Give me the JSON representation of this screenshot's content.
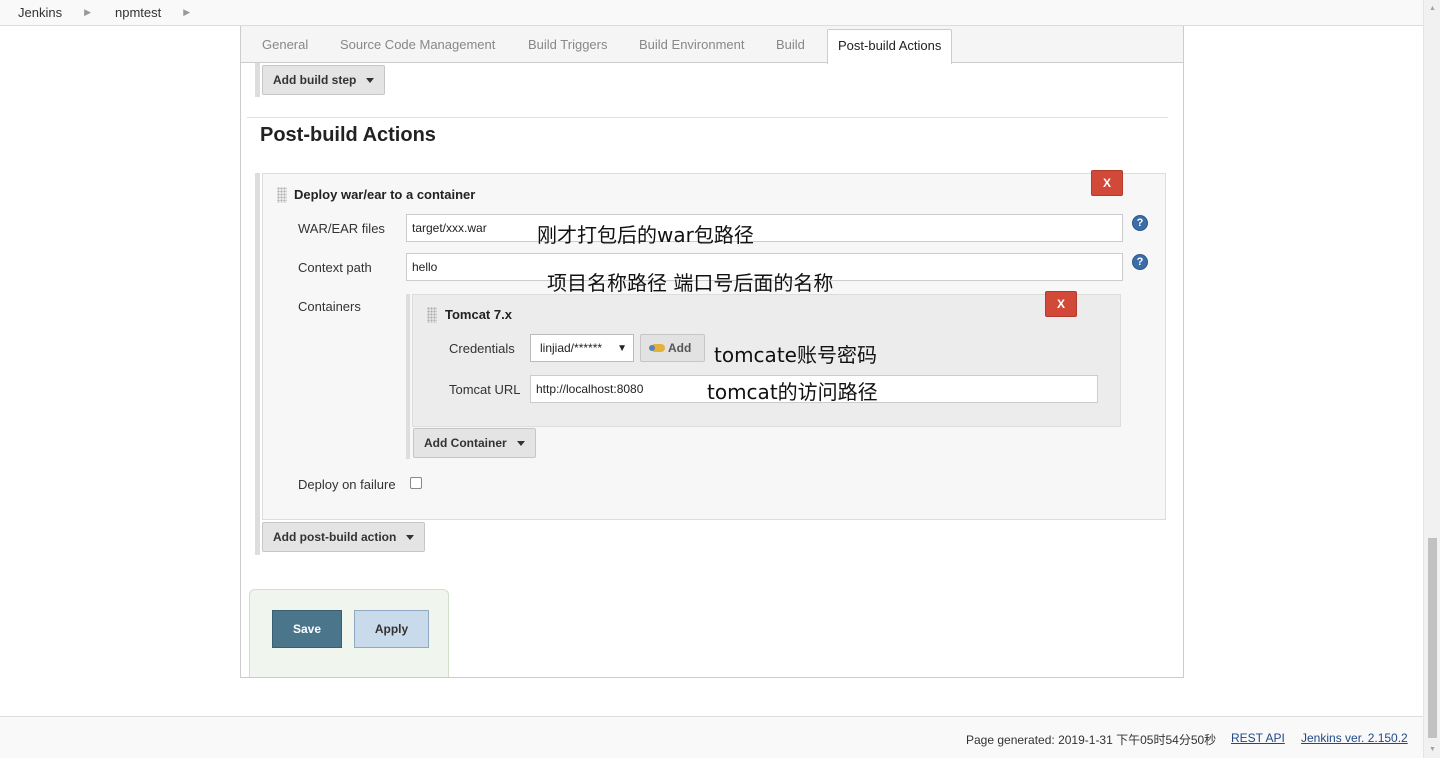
{
  "breadcrumb": {
    "items": [
      "Jenkins",
      "npmtest"
    ]
  },
  "tabs": [
    "General",
    "Source Code Management",
    "Build Triggers",
    "Build Environment",
    "Build",
    "Post-build Actions"
  ],
  "active_tab": "Post-build Actions",
  "build": {
    "add_step_label": "Add build step"
  },
  "post_build": {
    "title": "Post-build Actions",
    "deploy": {
      "title": "Deploy war/ear to a container",
      "remove_label": "X",
      "war_label": "WAR/EAR files",
      "war_value": "target/xxx.war",
      "context_label": "Context path",
      "context_value": "hello",
      "containers_label": "Containers",
      "container": {
        "title": "Tomcat 7.x",
        "remove_label": "X",
        "credentials_label": "Credentials",
        "credentials_value": "linjiad/******",
        "add_label": "Add",
        "url_label": "Tomcat URL",
        "url_value": "http://localhost:8080"
      },
      "add_container_label": "Add Container",
      "deploy_failure_label": "Deploy on failure"
    },
    "add_action_label": "Add post-build action"
  },
  "annotations": {
    "war": "刚才打包后的war包路径",
    "context": "项目名称路径 端口号后面的名称",
    "credentials": "tomcate账号密码",
    "url": "tomcat的访问路径"
  },
  "buttons": {
    "save": "Save",
    "apply": "Apply"
  },
  "help_glyph": "?",
  "footer": {
    "generated": "Page generated: 2019-1-31 下午05时54分50秒",
    "rest_api": "REST API",
    "version": "Jenkins ver. 2.150.2"
  }
}
